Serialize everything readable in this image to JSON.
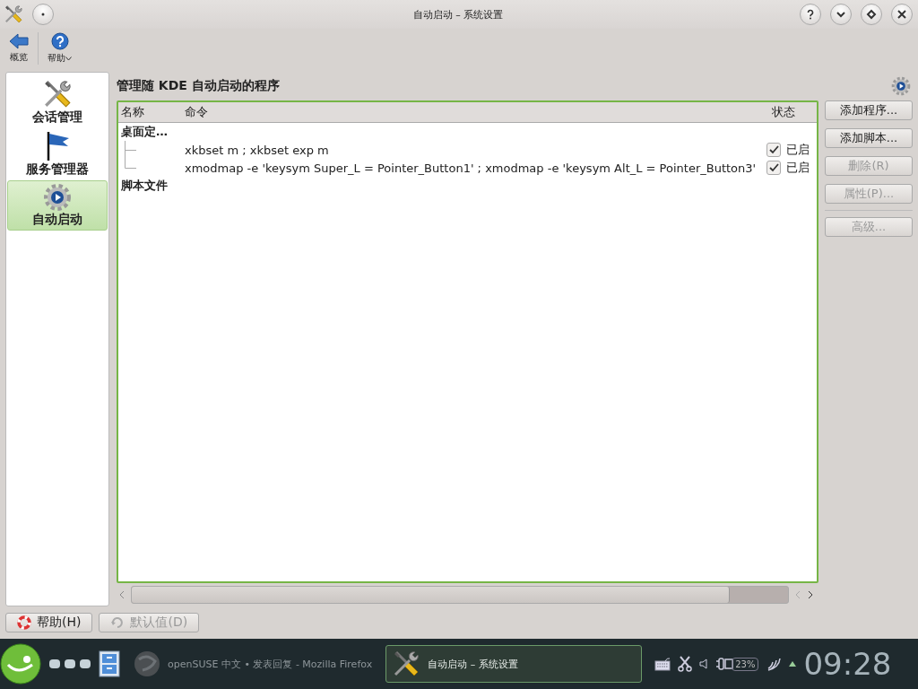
{
  "window": {
    "title": "自动启动 – 系统设置"
  },
  "toolbar": [
    {
      "label": "概览",
      "kind": "back"
    },
    {
      "label": "帮助",
      "kind": "help"
    }
  ],
  "sidebar": {
    "items": [
      {
        "label": "会话管理",
        "kind": "tools",
        "selected": false
      },
      {
        "label": "服务管理器",
        "kind": "flag",
        "selected": false
      },
      {
        "label": "自动启动",
        "kind": "gear",
        "selected": true
      }
    ]
  },
  "heading": "管理随 KDE 自动启动的程序",
  "table": {
    "columns": [
      "名称",
      "命令",
      "状态"
    ],
    "groups": [
      {
        "name": "桌面定…",
        "rows": [
          {
            "command": "xkbset m ; xkbset exp m",
            "checked": true,
            "status": "已启"
          },
          {
            "command": "xmodmap -e 'keysym Super_L = Pointer_Button1' ; xmodmap -e 'keysym Alt_L = Pointer_Button3'",
            "checked": true,
            "status": "已启"
          }
        ]
      },
      {
        "name": "脚本文件"
      }
    ]
  },
  "buttons": [
    {
      "label": "添加程序...",
      "disabled": false
    },
    {
      "label": "添加脚本...",
      "disabled": false
    },
    {
      "label": "删除(R)",
      "disabled": true
    },
    {
      "label": "属性(P)...",
      "disabled": true
    }
  ],
  "extra_buttons": [
    {
      "label": "高级...",
      "disabled": true
    }
  ],
  "footer_buttons": [
    {
      "label": "帮助(H)",
      "kind": "help",
      "disabled": false
    },
    {
      "label": "默认值(D)",
      "kind": "reset",
      "disabled": true
    }
  ],
  "taskbar": {
    "tasks": [
      {
        "label": "openSUSE 中文 • 发表回复 - Mozilla Firefox",
        "kind": "globe",
        "selected": false
      },
      {
        "label": "自动启动 – 系统设置",
        "kind": "tools",
        "selected": true
      }
    ],
    "battery": "23%",
    "clock": "09:28"
  }
}
